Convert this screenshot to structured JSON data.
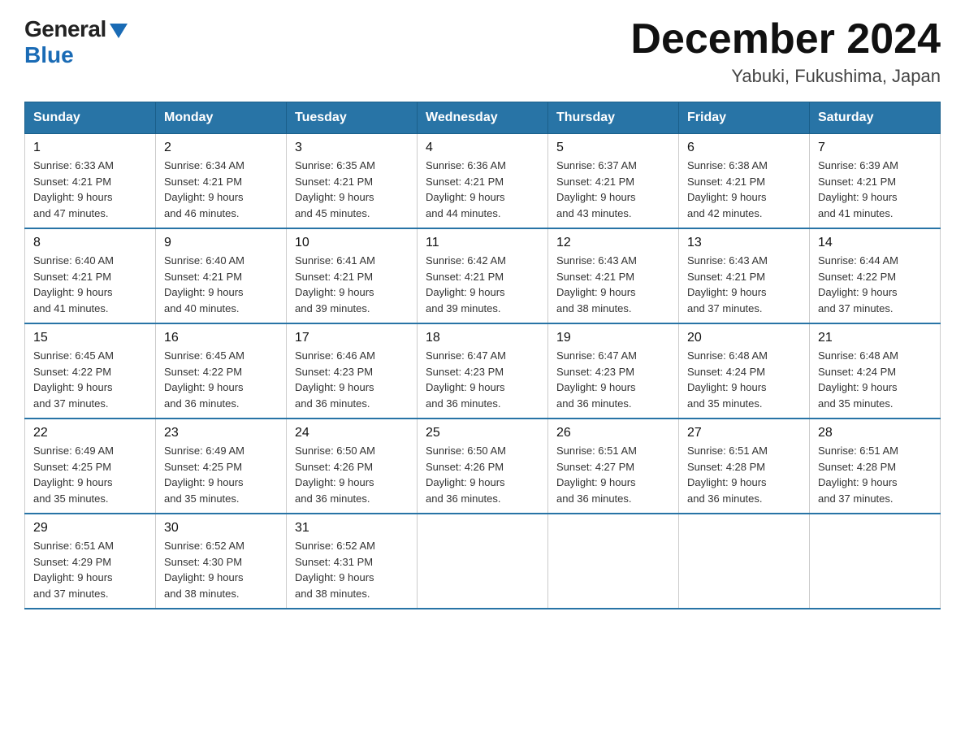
{
  "header": {
    "logo_general": "General",
    "logo_blue": "Blue",
    "title": "December 2024",
    "subtitle": "Yabuki, Fukushima, Japan"
  },
  "days_of_week": [
    "Sunday",
    "Monday",
    "Tuesday",
    "Wednesday",
    "Thursday",
    "Friday",
    "Saturday"
  ],
  "weeks": [
    [
      {
        "day": "1",
        "sunrise": "6:33 AM",
        "sunset": "4:21 PM",
        "daylight": "9 hours and 47 minutes."
      },
      {
        "day": "2",
        "sunrise": "6:34 AM",
        "sunset": "4:21 PM",
        "daylight": "9 hours and 46 minutes."
      },
      {
        "day": "3",
        "sunrise": "6:35 AM",
        "sunset": "4:21 PM",
        "daylight": "9 hours and 45 minutes."
      },
      {
        "day": "4",
        "sunrise": "6:36 AM",
        "sunset": "4:21 PM",
        "daylight": "9 hours and 44 minutes."
      },
      {
        "day": "5",
        "sunrise": "6:37 AM",
        "sunset": "4:21 PM",
        "daylight": "9 hours and 43 minutes."
      },
      {
        "day": "6",
        "sunrise": "6:38 AM",
        "sunset": "4:21 PM",
        "daylight": "9 hours and 42 minutes."
      },
      {
        "day": "7",
        "sunrise": "6:39 AM",
        "sunset": "4:21 PM",
        "daylight": "9 hours and 41 minutes."
      }
    ],
    [
      {
        "day": "8",
        "sunrise": "6:40 AM",
        "sunset": "4:21 PM",
        "daylight": "9 hours and 41 minutes."
      },
      {
        "day": "9",
        "sunrise": "6:40 AM",
        "sunset": "4:21 PM",
        "daylight": "9 hours and 40 minutes."
      },
      {
        "day": "10",
        "sunrise": "6:41 AM",
        "sunset": "4:21 PM",
        "daylight": "9 hours and 39 minutes."
      },
      {
        "day": "11",
        "sunrise": "6:42 AM",
        "sunset": "4:21 PM",
        "daylight": "9 hours and 39 minutes."
      },
      {
        "day": "12",
        "sunrise": "6:43 AM",
        "sunset": "4:21 PM",
        "daylight": "9 hours and 38 minutes."
      },
      {
        "day": "13",
        "sunrise": "6:43 AM",
        "sunset": "4:21 PM",
        "daylight": "9 hours and 37 minutes."
      },
      {
        "day": "14",
        "sunrise": "6:44 AM",
        "sunset": "4:22 PM",
        "daylight": "9 hours and 37 minutes."
      }
    ],
    [
      {
        "day": "15",
        "sunrise": "6:45 AM",
        "sunset": "4:22 PM",
        "daylight": "9 hours and 37 minutes."
      },
      {
        "day": "16",
        "sunrise": "6:45 AM",
        "sunset": "4:22 PM",
        "daylight": "9 hours and 36 minutes."
      },
      {
        "day": "17",
        "sunrise": "6:46 AM",
        "sunset": "4:23 PM",
        "daylight": "9 hours and 36 minutes."
      },
      {
        "day": "18",
        "sunrise": "6:47 AM",
        "sunset": "4:23 PM",
        "daylight": "9 hours and 36 minutes."
      },
      {
        "day": "19",
        "sunrise": "6:47 AM",
        "sunset": "4:23 PM",
        "daylight": "9 hours and 36 minutes."
      },
      {
        "day": "20",
        "sunrise": "6:48 AM",
        "sunset": "4:24 PM",
        "daylight": "9 hours and 35 minutes."
      },
      {
        "day": "21",
        "sunrise": "6:48 AM",
        "sunset": "4:24 PM",
        "daylight": "9 hours and 35 minutes."
      }
    ],
    [
      {
        "day": "22",
        "sunrise": "6:49 AM",
        "sunset": "4:25 PM",
        "daylight": "9 hours and 35 minutes."
      },
      {
        "day": "23",
        "sunrise": "6:49 AM",
        "sunset": "4:25 PM",
        "daylight": "9 hours and 35 minutes."
      },
      {
        "day": "24",
        "sunrise": "6:50 AM",
        "sunset": "4:26 PM",
        "daylight": "9 hours and 36 minutes."
      },
      {
        "day": "25",
        "sunrise": "6:50 AM",
        "sunset": "4:26 PM",
        "daylight": "9 hours and 36 minutes."
      },
      {
        "day": "26",
        "sunrise": "6:51 AM",
        "sunset": "4:27 PM",
        "daylight": "9 hours and 36 minutes."
      },
      {
        "day": "27",
        "sunrise": "6:51 AM",
        "sunset": "4:28 PM",
        "daylight": "9 hours and 36 minutes."
      },
      {
        "day": "28",
        "sunrise": "6:51 AM",
        "sunset": "4:28 PM",
        "daylight": "9 hours and 37 minutes."
      }
    ],
    [
      {
        "day": "29",
        "sunrise": "6:51 AM",
        "sunset": "4:29 PM",
        "daylight": "9 hours and 37 minutes."
      },
      {
        "day": "30",
        "sunrise": "6:52 AM",
        "sunset": "4:30 PM",
        "daylight": "9 hours and 38 minutes."
      },
      {
        "day": "31",
        "sunrise": "6:52 AM",
        "sunset": "4:31 PM",
        "daylight": "9 hours and 38 minutes."
      },
      null,
      null,
      null,
      null
    ]
  ],
  "labels": {
    "sunrise": "Sunrise:",
    "sunset": "Sunset:",
    "daylight": "Daylight:"
  }
}
